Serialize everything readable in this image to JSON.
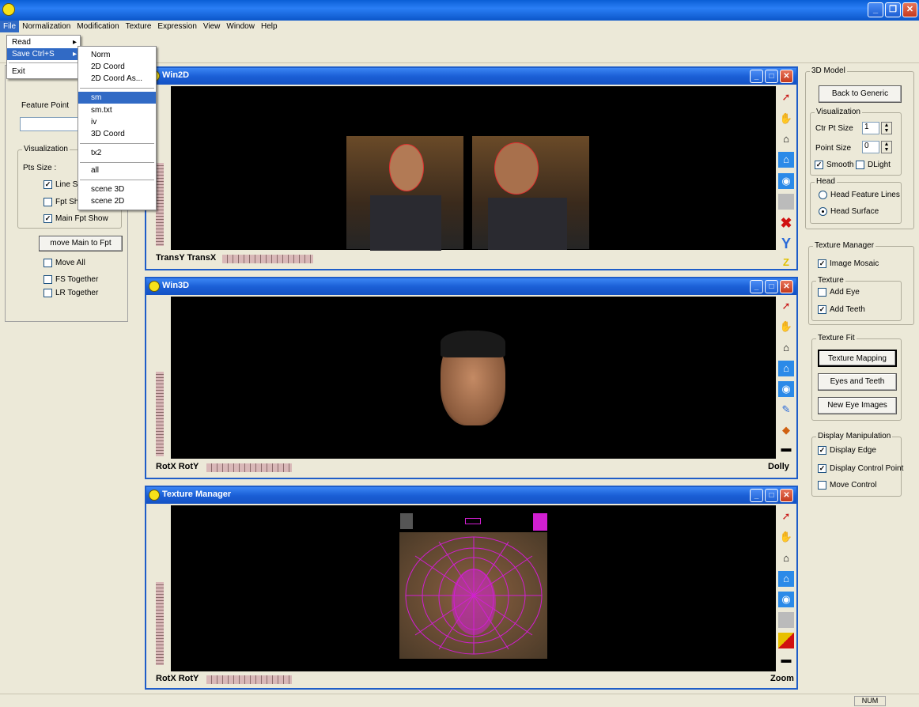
{
  "menubar": {
    "items": [
      "File",
      "Normalization",
      "Modification",
      "Texture",
      "Expression",
      "View",
      "Window",
      "Help"
    ]
  },
  "file_menu": {
    "items": [
      {
        "label": "Read",
        "arrow": "▸"
      },
      {
        "label": "Save  Ctrl+S",
        "arrow": "▸"
      },
      {
        "label": "Exit"
      }
    ]
  },
  "save_submenu": {
    "items": [
      "Norm",
      "2D Coord",
      "2D Coord As...",
      "sm",
      "sm.txt",
      "iv",
      "3D Coord",
      "tx2",
      "all",
      "scene 3D",
      "scene 2D"
    ]
  },
  "left_panel": {
    "feature_point": "Feature Point",
    "visualization": "Visualization",
    "pts_size": "Pts Size :",
    "line_show": "Line S",
    "fpt_show": "Fpt Sh",
    "main_fpt_show": "Main Fpt Show",
    "move_main_btn": "move Main to Fpt",
    "move_all": "Move All",
    "fs_together": "FS Together",
    "lr_together": "LR Together"
  },
  "win2d": {
    "title": "Win2D",
    "caption": "TransY TransX"
  },
  "win3d": {
    "title": "Win3D",
    "caption": "RotX RotY",
    "right_caption": "Dolly"
  },
  "texwin": {
    "title": "Texture Manager",
    "caption": "RotX RotY",
    "right_caption": "Zoom"
  },
  "right_panel": {
    "model_group": "3D Model",
    "back_btn": "Back to Generic",
    "vis_group": "Visualization",
    "ctr_pt_size": "Ctr Pt Size",
    "ctr_pt_val": "1",
    "point_size": "Point Size",
    "point_val": "0",
    "smooth": "Smooth",
    "dlight": "DLight",
    "head_group": "Head",
    "head_lines": "Head Feature Lines",
    "head_surface": "Head Surface",
    "tex_mgr_group": "Texture Manager",
    "image_mosaic": "Image Mosaic",
    "texture_group": "Texture",
    "add_eye": "Add Eye",
    "add_teeth": "Add Teeth",
    "texfit_group": "Texture Fit",
    "tex_mapping_btn": "Texture Mapping",
    "eyes_teeth_btn": "Eyes and Teeth",
    "new_eye_btn": "New Eye Images",
    "display_group": "Display Manipulation",
    "display_edge": "Display Edge",
    "display_ctrl": "Display Control Point",
    "move_control": "Move Control"
  },
  "status": {
    "num": "NUM"
  },
  "colors": {
    "accent": "#316ac5",
    "titlebar": "#0a5fd6",
    "mesh": "#d21fd2"
  }
}
